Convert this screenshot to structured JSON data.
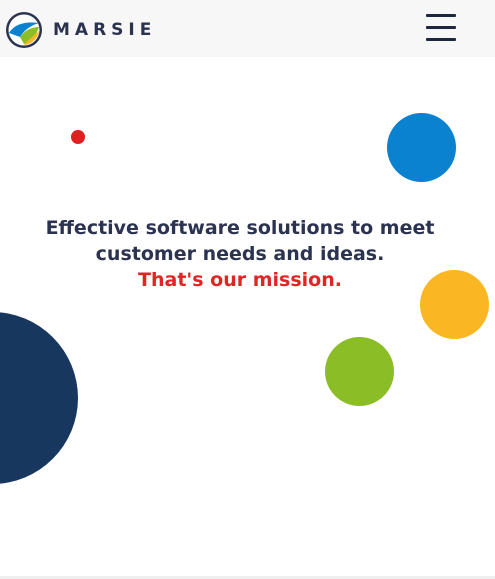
{
  "brand": {
    "name": "MARSIE",
    "logo_icon": "marsie-circle-logo-icon",
    "colors": {
      "navy": "#2b3350",
      "blue": "#0a82d0",
      "green": "#8bbd26",
      "yellow": "#fbb723",
      "red": "#e02020"
    }
  },
  "header": {
    "menu_icon": "hamburger-menu-icon"
  },
  "hero": {
    "headline_line1": "Effective software solutions to meet",
    "headline_line2": "customer needs and ideas.",
    "mission_text": "That's our mission."
  }
}
